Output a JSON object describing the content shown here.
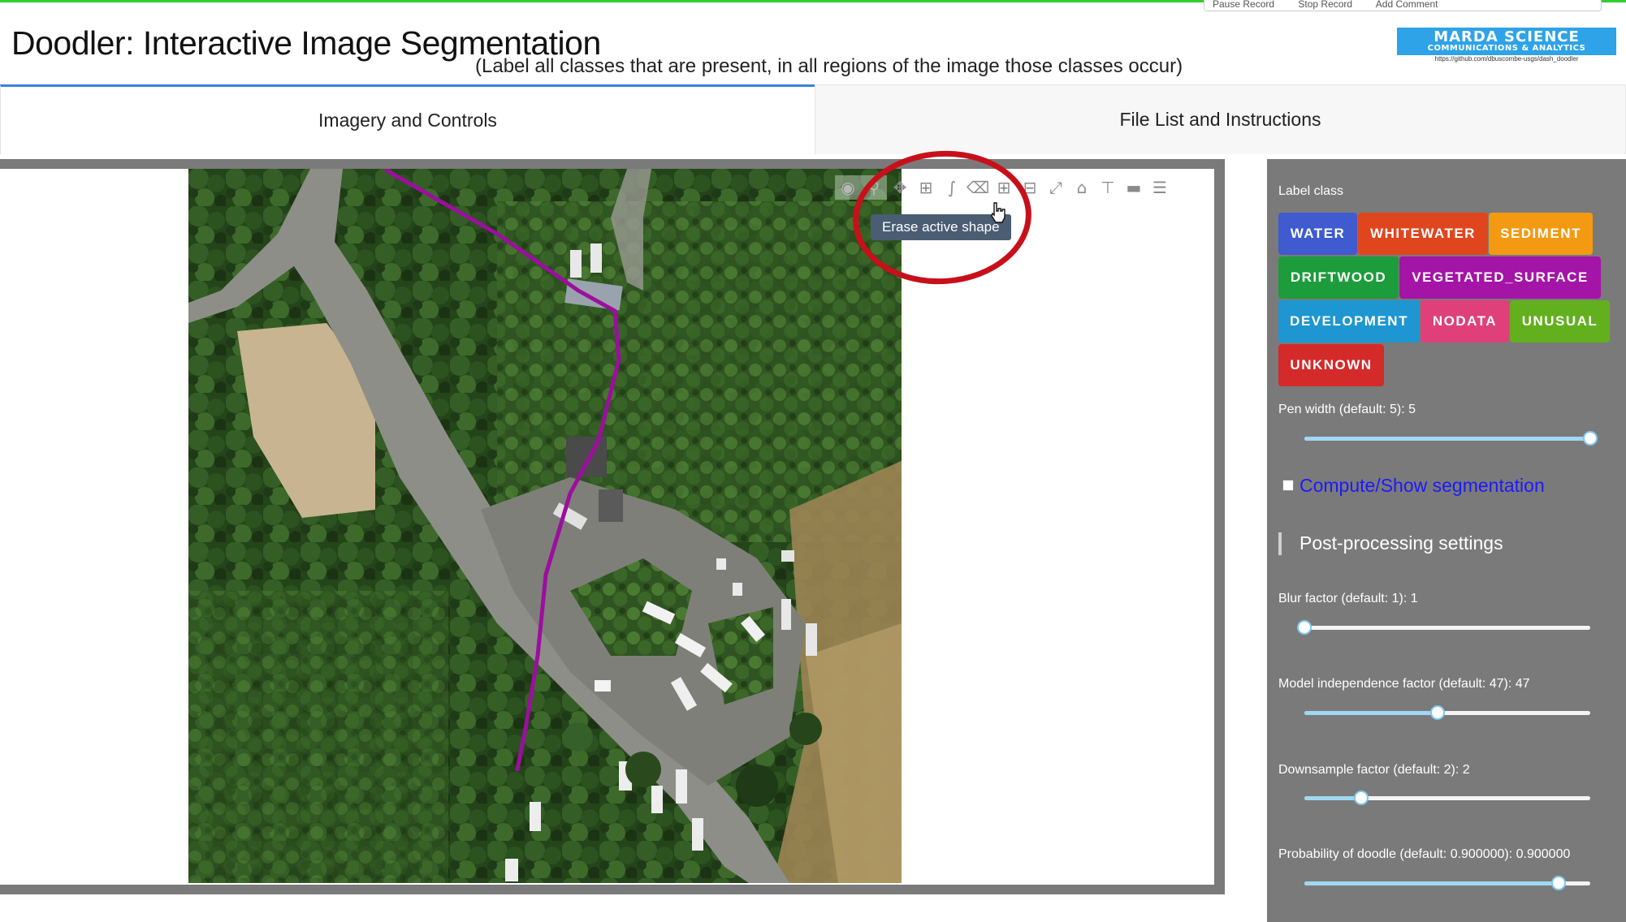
{
  "recorder": {
    "pause": "Pause Record",
    "stop": "Stop Record",
    "comment": "Add Comment"
  },
  "header": {
    "title": "Doodler: Interactive Image Segmentation",
    "subtitle": "(Label all classes that are present, in all regions of the image those classes occur)"
  },
  "logo": {
    "line1": "MARDA SCIENCE",
    "line2": "COMMUNICATIONS & ANALYTICS",
    "line3": "https://github.com/dbuscombe-usgs/dash_doodler"
  },
  "tabs": [
    {
      "label": "Imagery and Controls",
      "active": true
    },
    {
      "label": "File List and Instructions",
      "active": false
    }
  ],
  "graph": {
    "tooltip": "Erase active shape",
    "modebar_icons": [
      "camera-icon",
      "zoom-icon",
      "pan-icon",
      "box-select-icon",
      "draw-open-path-icon",
      "erase-shape-icon",
      "zoom-in-icon",
      "zoom-out-icon",
      "autoscale-icon",
      "reset-axes-icon",
      "spike-lines-icon",
      "hover-closest-icon",
      "hover-compare-icon"
    ],
    "stroke_color": "#9b0f9e"
  },
  "panel": {
    "label_class_title": "Label class",
    "classes": [
      {
        "label": "WATER",
        "color": "#3f5bcf"
      },
      {
        "label": "WHITEWATER",
        "color": "#e0461e"
      },
      {
        "label": "SEDIMENT",
        "color": "#f39a12"
      },
      {
        "label": "DRIFTWOOD",
        "color": "#1c9c3a"
      },
      {
        "label": "VEGETATED_SURFACE",
        "color": "#a414a6"
      },
      {
        "label": "DEVELOPMENT",
        "color": "#1d96d1"
      },
      {
        "label": "NODATA",
        "color": "#e0407a"
      },
      {
        "label": "UNUSUAL",
        "color": "#63b01f"
      },
      {
        "label": "UNKNOWN",
        "color": "#d42a2a"
      }
    ],
    "pen_width_label": "Pen width (default: 5): 5",
    "pen_width_value": 1.0,
    "compute_label": "Compute/Show segmentation",
    "compute_checked": false,
    "post_heading": "Post-processing settings",
    "blur_label": "Blur factor (default: 1): 1",
    "blur_value": 0.0,
    "model_label": "Model independence factor (default: 47): 47",
    "model_value": 0.465,
    "downsample_label": "Downsample factor (default: 2): 2",
    "downsample_value": 0.2,
    "prob_label": "Probability of doodle (default: 0.900000): 0.900000",
    "prob_value": 0.89
  }
}
